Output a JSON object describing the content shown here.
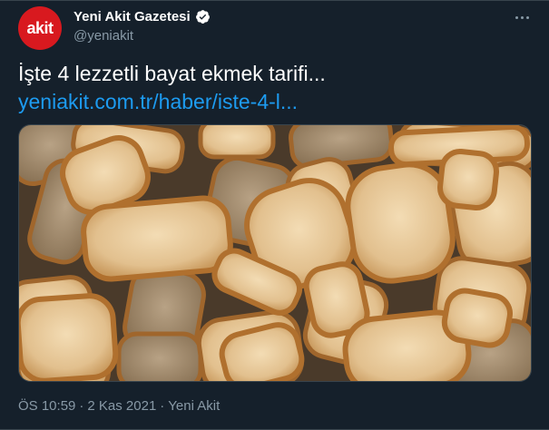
{
  "author": {
    "avatar_text": "akit",
    "display_name": "Yeni Akit Gazetesi",
    "handle": "@yeniakit",
    "verified": true
  },
  "tweet": {
    "text": "İşte 4 lezzetli bayat ekmek tarifi...",
    "link": "yeniakit.com.tr/haber/iste-4-l..."
  },
  "media": {
    "icon": "photo-of-bread-slices"
  },
  "meta": {
    "time": "ÖS 10:59",
    "separator_1": "·",
    "date": "2 Kas 2021",
    "separator_2": "·",
    "source": "Yeni Akit"
  },
  "colors": {
    "background": "#15202b",
    "link": "#1d9bf0",
    "secondary_text": "#8899a6",
    "avatar": "#d8191f",
    "verified_badge": "#ffffff"
  }
}
